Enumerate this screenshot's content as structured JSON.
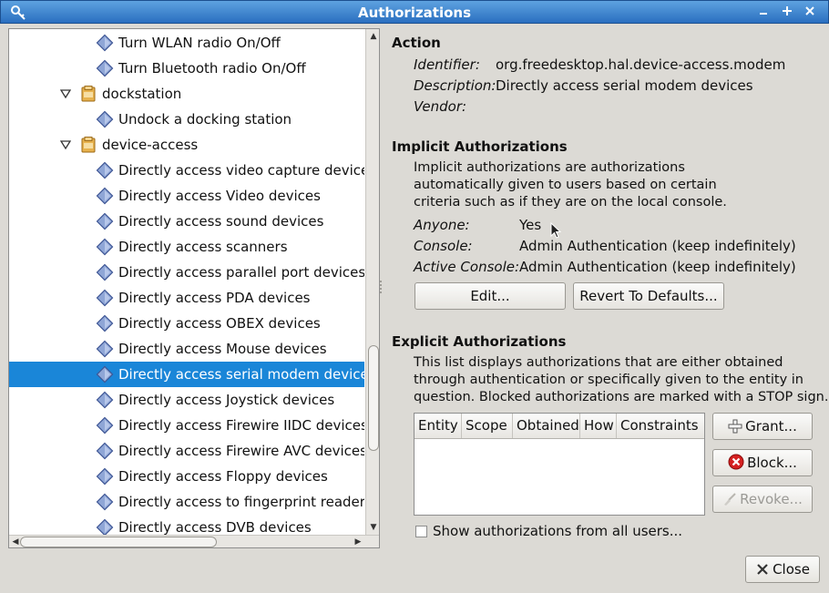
{
  "window": {
    "title": "Authorizations",
    "accent": "#2a6fc0",
    "selection_color": "#1a86d8"
  },
  "tree": {
    "rows": [
      {
        "label": "Turn WLAN radio On/Off",
        "level": 2,
        "icon": "action-diamond-icon"
      },
      {
        "label": "Turn Bluetooth radio On/Off",
        "level": 2,
        "icon": "action-diamond-icon"
      },
      {
        "label": "dockstation",
        "level": 1,
        "icon": "folder-icon",
        "expanded": true
      },
      {
        "label": "Undock a docking station",
        "level": 2,
        "icon": "action-diamond-icon"
      },
      {
        "label": "device-access",
        "level": 1,
        "icon": "folder-icon",
        "expanded": true
      },
      {
        "label": "Directly access video capture devices",
        "level": 2,
        "icon": "action-diamond-icon"
      },
      {
        "label": "Directly access Video devices",
        "level": 2,
        "icon": "action-diamond-icon"
      },
      {
        "label": "Directly access sound devices",
        "level": 2,
        "icon": "action-diamond-icon"
      },
      {
        "label": "Directly access scanners",
        "level": 2,
        "icon": "action-diamond-icon"
      },
      {
        "label": "Directly access parallel port devices",
        "level": 2,
        "icon": "action-diamond-icon"
      },
      {
        "label": "Directly access PDA devices",
        "level": 2,
        "icon": "action-diamond-icon"
      },
      {
        "label": "Directly access OBEX devices",
        "level": 2,
        "icon": "action-diamond-icon"
      },
      {
        "label": "Directly access Mouse devices",
        "level": 2,
        "icon": "action-diamond-icon"
      },
      {
        "label": "Directly access serial modem devices",
        "level": 2,
        "icon": "action-diamond-icon",
        "selected": true
      },
      {
        "label": "Directly access Joystick devices",
        "level": 2,
        "icon": "action-diamond-icon"
      },
      {
        "label": "Directly access Firewire IIDC devices",
        "level": 2,
        "icon": "action-diamond-icon"
      },
      {
        "label": "Directly access Firewire AVC devices",
        "level": 2,
        "icon": "action-diamond-icon"
      },
      {
        "label": "Directly access Floppy devices",
        "level": 2,
        "icon": "action-diamond-icon"
      },
      {
        "label": "Directly access to fingerprint reader devices",
        "level": 2,
        "icon": "action-diamond-icon"
      },
      {
        "label": "Directly access DVB devices",
        "level": 2,
        "icon": "action-diamond-icon"
      }
    ]
  },
  "action": {
    "title": "Action",
    "identifier_key": "Identifier:",
    "identifier": "org.freedesktop.hal.device-access.modem",
    "description_key": "Description:",
    "description": "Directly access serial modem devices",
    "vendor_key": "Vendor:",
    "vendor": ""
  },
  "implicit": {
    "title": "Implicit Authorizations",
    "text_lines": [
      "Implicit authorizations are authorizations",
      "automatically given to users based on certain",
      "criteria such as if they are on the local console."
    ],
    "anyone_key": "Anyone:",
    "anyone": "Yes",
    "console_key": "Console:",
    "console": "Admin Authentication (keep indefinitely)",
    "active_key": "Active Console:",
    "active": "Admin Authentication (keep indefinitely)",
    "edit_label": "Edit...",
    "revert_label": "Revert To Defaults..."
  },
  "explicit": {
    "title": "Explicit Authorizations",
    "text_lines": [
      "This list displays authorizations that are either obtained",
      "through authentication or specifically given to the entity in",
      "question. Blocked authorizations are marked with a STOP sign."
    ],
    "columns": [
      "Entity",
      "Scope",
      "Obtained",
      "How",
      "Constraints"
    ],
    "grant_label": "Grant...",
    "block_label": "Block...",
    "revoke_label": "Revoke...",
    "show_all_label": "Show authorizations from all users...",
    "show_all_checked": false
  },
  "footer": {
    "close_label": "Close"
  }
}
